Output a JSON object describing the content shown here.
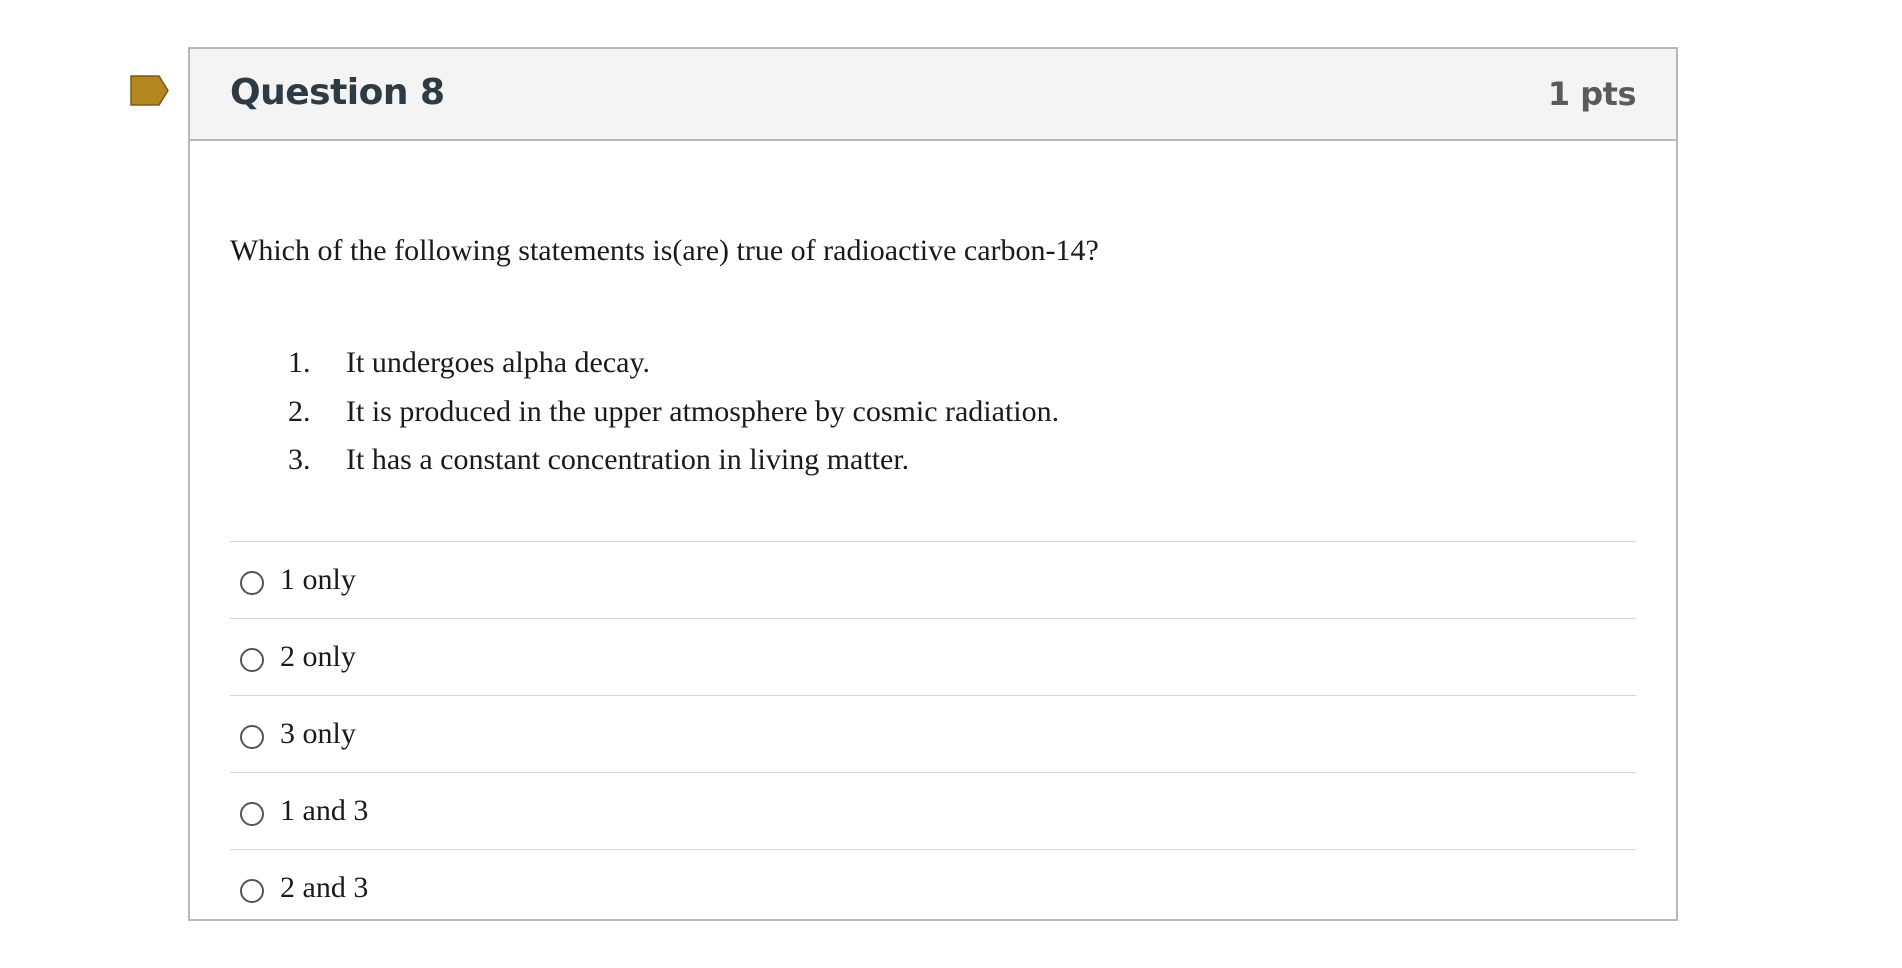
{
  "question": {
    "title": "Question 8",
    "points": "1 pts",
    "flag_icon": "bookmark-flag-icon",
    "flag_color": "#b3861e",
    "text": "Which of the following statements is(are) true of radioactive carbon-14?",
    "statements": [
      {
        "num": "1.",
        "text": "It undergoes alpha decay."
      },
      {
        "num": "2.",
        "text": "It is produced in the upper atmosphere by cosmic radiation."
      },
      {
        "num": "3.",
        "text": "It has a constant concentration in living matter."
      }
    ],
    "answers": [
      {
        "label": "1 only",
        "selected": false
      },
      {
        "label": "2 only",
        "selected": false
      },
      {
        "label": "3 only",
        "selected": false
      },
      {
        "label": "1 and 3",
        "selected": false
      },
      {
        "label": "2 and 3",
        "selected": false
      }
    ]
  }
}
